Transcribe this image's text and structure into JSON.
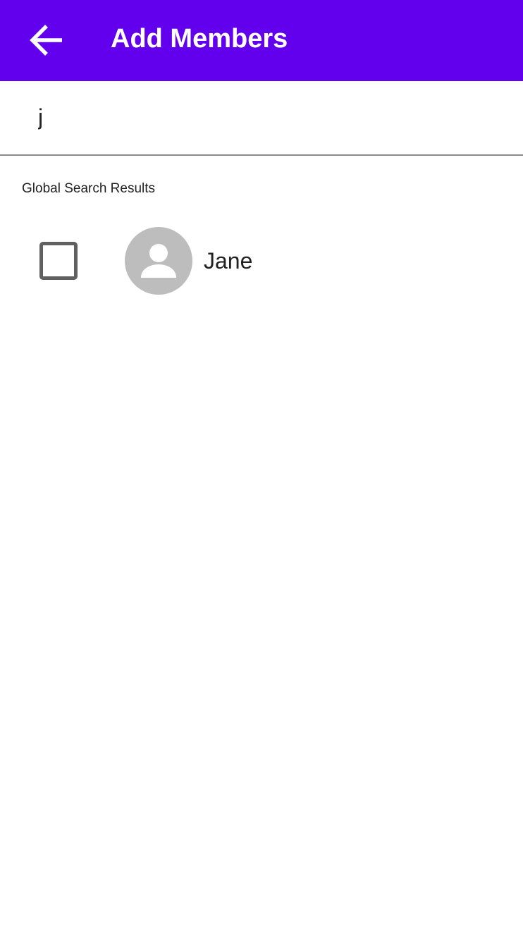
{
  "app_bar": {
    "title": "Add Members",
    "back_icon": "arrow-back-icon",
    "background_color": "#6200EE"
  },
  "search": {
    "value": "j",
    "placeholder": ""
  },
  "results": {
    "section_title": "Global Search Results",
    "items": [
      {
        "name": "Jane",
        "checked": false,
        "avatar_icon": "person-icon"
      }
    ]
  }
}
